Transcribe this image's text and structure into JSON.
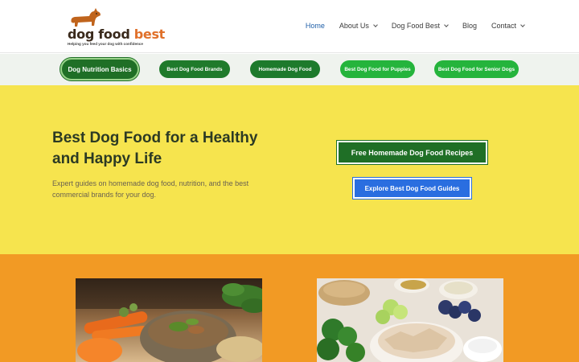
{
  "header": {
    "logo": {
      "brand_main": "dog food ",
      "brand_accent": "best",
      "tagline": "Helping you feed your dog with confidence"
    },
    "nav": [
      {
        "label": "Home",
        "active": true,
        "dropdown": false
      },
      {
        "label": "About Us",
        "active": false,
        "dropdown": true
      },
      {
        "label": "Dog Food Best",
        "active": false,
        "dropdown": true
      },
      {
        "label": "Blog",
        "active": false,
        "dropdown": false
      },
      {
        "label": "Contact",
        "active": false,
        "dropdown": true
      }
    ]
  },
  "pills": [
    "Dog Nutrition Basics",
    "Best Dog Food Brands",
    "Homemade Dog Food",
    "Best Dog Food for Puppies",
    "Best Dog Food for Senior Dogs"
  ],
  "hero": {
    "title": "Best Dog Food for a Healthy and Happy Life",
    "subtitle": "Expert guides on homemade dog food, nutrition, and the best commercial brands for your dog.",
    "primary_button": "Free Homemade Dog Food Recipes",
    "secondary_button": "Explore Best Dog Food Guides"
  },
  "colors": {
    "brand_green": "#1f6f26",
    "light_green": "#25b43c",
    "hero_yellow": "#f6e44e",
    "section_orange": "#f29a24",
    "blue_button": "#2a6ee0",
    "nav_active": "#1f5fa8",
    "logo_accent": "#e0702a"
  },
  "images": [
    {
      "icon": "dog-food-bowl-photo"
    },
    {
      "icon": "chicken-and-vegetables-photo"
    }
  ]
}
